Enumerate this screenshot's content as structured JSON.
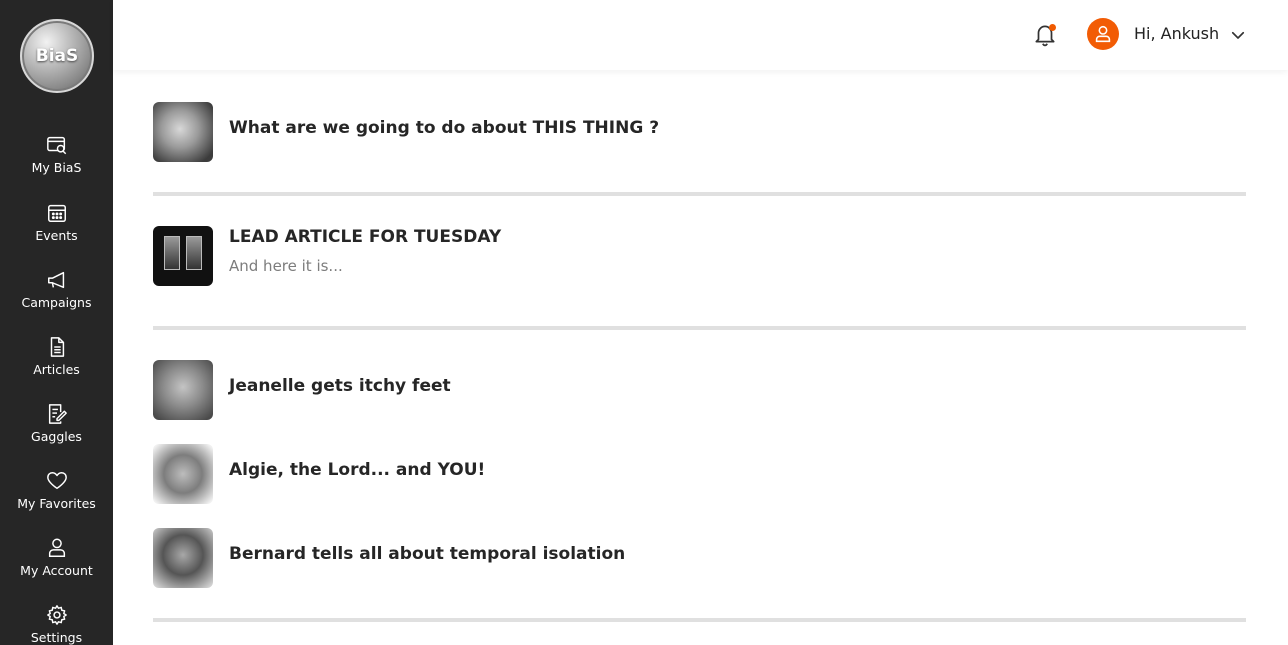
{
  "brand": {
    "logo_text": "BiaS"
  },
  "sidebar": {
    "items": [
      {
        "label": "My BiaS",
        "icon": "browser-search-icon"
      },
      {
        "label": "Events",
        "icon": "calendar-icon"
      },
      {
        "label": "Campaigns",
        "icon": "megaphone-icon"
      },
      {
        "label": "Articles",
        "icon": "document-icon"
      },
      {
        "label": "Gaggles",
        "icon": "edit-document-icon"
      },
      {
        "label": "My Favorites",
        "icon": "heart-icon"
      },
      {
        "label": "My Account",
        "icon": "user-icon"
      },
      {
        "label": "Settings",
        "icon": "gear-icon"
      }
    ]
  },
  "header": {
    "greeting": "Hi, Ankush",
    "notification_dot_color": "#f05a00",
    "avatar_color": "#f25c05"
  },
  "feed": {
    "groups": [
      {
        "items": [
          {
            "title": "What are we going to do about THIS THING ?",
            "subtitle": ""
          }
        ]
      },
      {
        "items": [
          {
            "title": "LEAD ARTICLE FOR TUESDAY",
            "subtitle": "And here it is..."
          }
        ]
      },
      {
        "items": [
          {
            "title": "Jeanelle gets itchy feet",
            "subtitle": ""
          },
          {
            "title": "Algie, the Lord... and YOU!",
            "subtitle": ""
          },
          {
            "title": "Bernard tells all about temporal isolation",
            "subtitle": ""
          }
        ]
      }
    ]
  }
}
